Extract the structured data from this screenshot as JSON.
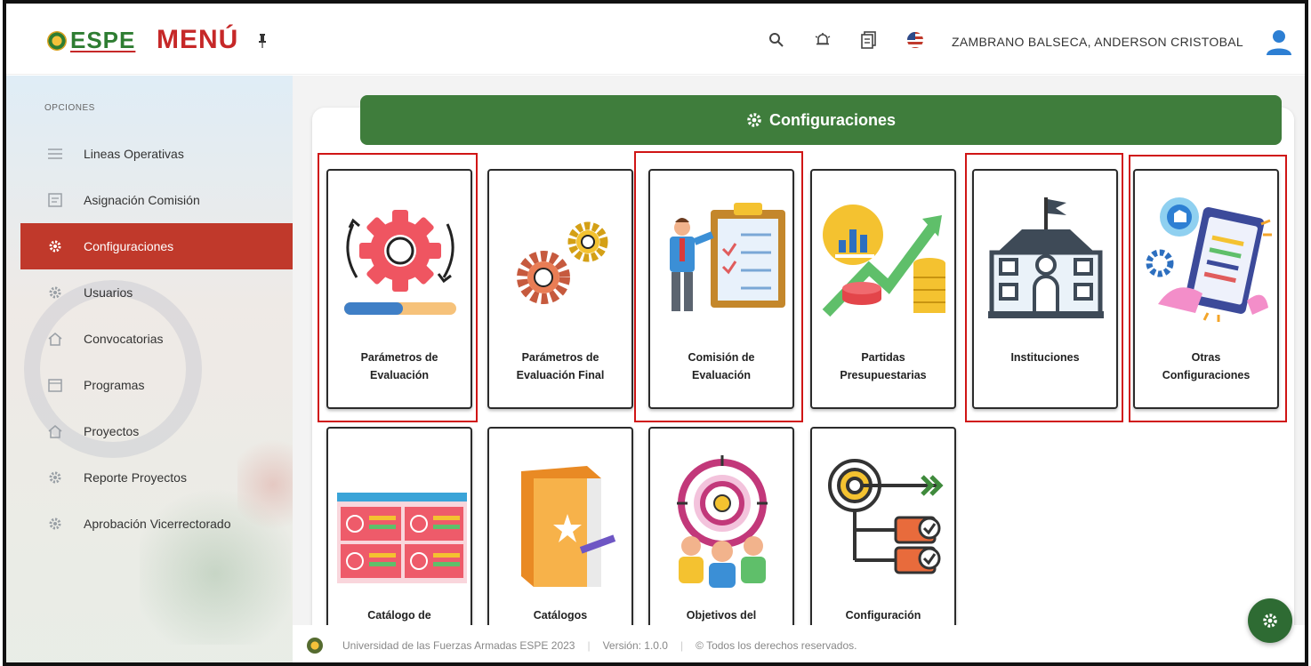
{
  "topbar": {
    "logo_text": "ESPE",
    "menu_title": "MENÚ",
    "user_name": "ZAMBRANO BALSECA, ANDERSON CRISTOBAL",
    "icons": [
      "search-icon",
      "bell-icon",
      "clipboard-icon",
      "us-flag-icon"
    ]
  },
  "sidebar": {
    "section_label": "OPCIONES",
    "items": [
      {
        "label": "Lineas Operativas",
        "icon": "list-icon",
        "active": false
      },
      {
        "label": "Asignación Comisión",
        "icon": "form-icon",
        "active": false
      },
      {
        "label": "Configuraciones",
        "icon": "gear-icon",
        "active": true
      },
      {
        "label": "Usuarios",
        "icon": "gear-icon",
        "active": false
      },
      {
        "label": "Convocatorias",
        "icon": "home-icon",
        "active": false
      },
      {
        "label": "Programas",
        "icon": "calendar-icon",
        "active": false
      },
      {
        "label": "Proyectos",
        "icon": "home-icon",
        "active": false
      },
      {
        "label": "Reporte Proyectos",
        "icon": "gear-icon",
        "active": false
      },
      {
        "label": "Aprobación Vicerrectorado",
        "icon": "gear-icon",
        "active": false
      }
    ]
  },
  "main": {
    "header_title": "Configuraciones",
    "tiles_row1": [
      {
        "label_line1": "Parámetros de",
        "label_line2": "Evaluación",
        "highlighted": true
      },
      {
        "label_line1": "Parámetros de",
        "label_line2": "Evaluación Final",
        "highlighted": false
      },
      {
        "label_line1": "Comisión de",
        "label_line2": "Evaluación",
        "highlighted": true
      },
      {
        "label_line1": "Partidas",
        "label_line2": "Presupuestarias",
        "highlighted": false
      },
      {
        "label_line1": "Instituciones",
        "label_line2": "",
        "highlighted": true
      },
      {
        "label_line1": "Otras",
        "label_line2": "Configuraciones",
        "highlighted": true
      }
    ],
    "tiles_row2": [
      {
        "label_line1": "Catálogo de"
      },
      {
        "label_line1": "Catálogos"
      },
      {
        "label_line1": "Objetivos del"
      },
      {
        "label_line1": "Configuración"
      }
    ]
  },
  "footer": {
    "university": "Universidad de las Fuerzas Armadas ESPE 2023",
    "version": "Versión: 1.0.0",
    "rights": "© Todos los derechos reservados."
  },
  "colors": {
    "brand_green": "#3f7d3c",
    "brand_red": "#c0392b",
    "highlight_red": "#d01515"
  }
}
